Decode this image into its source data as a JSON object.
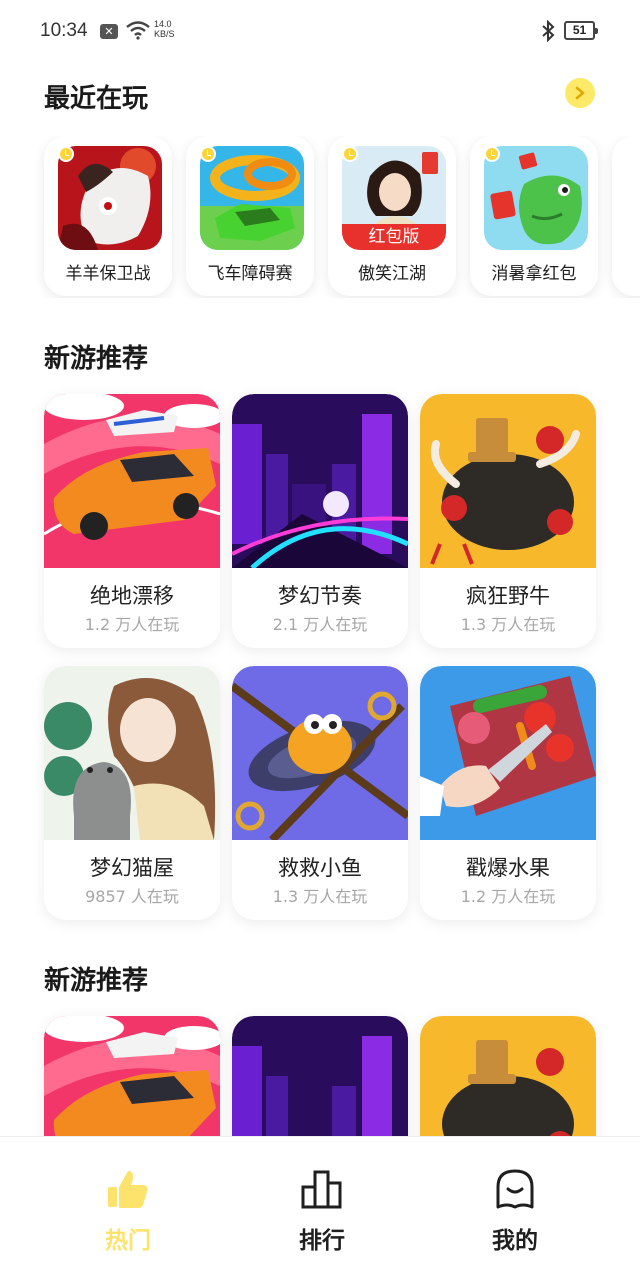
{
  "status_bar": {
    "time": "10:34",
    "net_speed_value": "14.0",
    "net_speed_unit": "KB/S",
    "battery": "51",
    "icons": [
      "message-icon",
      "wifi-icon",
      "bluetooth-icon",
      "battery-icon"
    ]
  },
  "recent": {
    "title": "最近在玩",
    "more_icon": "chevron-right-icon",
    "items": [
      {
        "name": "羊羊保卫战",
        "badge": ""
      },
      {
        "name": "飞车障碍赛",
        "badge": ""
      },
      {
        "name": "傲笑江湖",
        "badge": "红包版"
      },
      {
        "name": "消暑拿红包",
        "badge": ""
      }
    ]
  },
  "section1": {
    "title": "新游推荐",
    "games": [
      {
        "name": "绝地漂移",
        "players": "1.2 万人在玩"
      },
      {
        "name": "梦幻节奏",
        "players": "2.1 万人在玩"
      },
      {
        "name": "疯狂野牛",
        "players": "1.3 万人在玩"
      },
      {
        "name": "梦幻猫屋",
        "players": "9857 人在玩"
      },
      {
        "name": "救救小鱼",
        "players": "1.3 万人在玩"
      },
      {
        "name": "戳爆水果",
        "players": "1.2 万人在玩"
      }
    ]
  },
  "section2": {
    "title": "新游推荐"
  },
  "nav": {
    "items": [
      {
        "label": "热门",
        "icon": "thumbs-up-icon",
        "active": true
      },
      {
        "label": "排行",
        "icon": "ranking-icon",
        "active": false
      },
      {
        "label": "我的",
        "icon": "profile-ghost-icon",
        "active": false
      }
    ]
  },
  "colors": {
    "accent_yellow": "#fde36b",
    "badge_red": "#e8302c",
    "muted_text": "#a7a7a7"
  }
}
